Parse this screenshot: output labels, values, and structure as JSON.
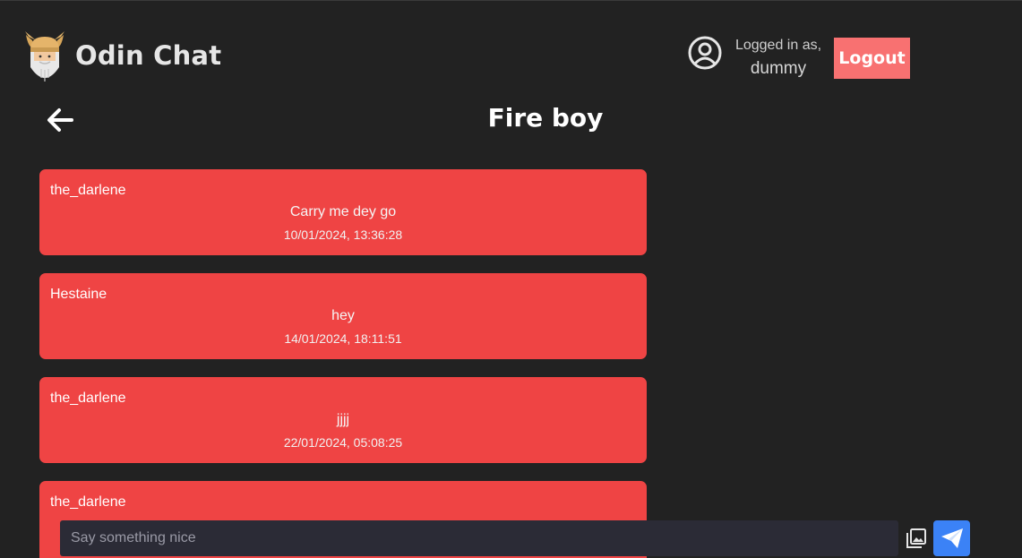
{
  "header": {
    "app_title": "Odin Chat",
    "logged_in_label": "Logged in as,",
    "username": "dummy",
    "logout_label": "Logout"
  },
  "chat": {
    "title": "Fire boy"
  },
  "messages": [
    {
      "sender": "the_darlene",
      "text": "Carry me dey go",
      "time": "10/01/2024, 13:36:28"
    },
    {
      "sender": "Hestaine",
      "text": "hey",
      "time": "14/01/2024, 18:11:51"
    },
    {
      "sender": "the_darlene",
      "text": "jjjj",
      "time": "22/01/2024, 05:08:25"
    },
    {
      "sender": "the_darlene",
      "text": "",
      "time": ""
    }
  ],
  "composer": {
    "placeholder": "Say something nice"
  },
  "colors": {
    "background": "#222222",
    "message_bubble": "#ef4444",
    "logout_button": "#f87171",
    "send_button": "#3b82f6",
    "input_background": "#2b2b36"
  },
  "icons": {
    "logo": "viking-logo-icon",
    "user": "user-circle-icon",
    "back": "arrow-left-icon",
    "image": "image-upload-icon",
    "send": "paper-plane-icon"
  }
}
